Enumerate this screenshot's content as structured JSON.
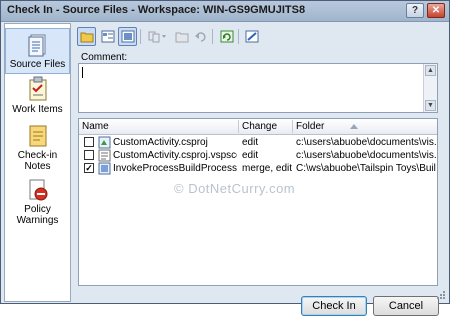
{
  "window": {
    "title": "Check In - Source Files - Workspace: WIN-GS9GMUJITS8"
  },
  "sidebar": {
    "items": [
      {
        "label": "Source Files",
        "icon": "source-files-icon",
        "selected": true
      },
      {
        "label": "Work Items",
        "icon": "work-items-icon"
      },
      {
        "label": "Check-in Notes",
        "icon": "checkin-notes-icon"
      },
      {
        "label": "Policy Warnings",
        "icon": "policy-warnings-icon"
      }
    ]
  },
  "comment": {
    "label": "Comment:",
    "value": ""
  },
  "files": {
    "columns": [
      "Name",
      "Change",
      "Folder"
    ],
    "rows": [
      {
        "checked": false,
        "name": "CustomActivity.csproj",
        "change": "edit",
        "folder": "c:\\users\\abuobe\\documents\\vis..."
      },
      {
        "checked": false,
        "name": "CustomActivity.csproj.vspscc",
        "change": "edit",
        "folder": "c:\\users\\abuobe\\documents\\vis..."
      },
      {
        "checked": true,
        "name": "InvokeProcessBuildProcessTe...",
        "change": "merge, edit",
        "folder": "C:\\ws\\abuobe\\Tailspin Toys\\Buil..."
      }
    ]
  },
  "watermark": "© DotNetCurry.com",
  "buttons": {
    "check_in": "Check In",
    "cancel": "Cancel"
  },
  "colors": {
    "accent": "#5c82b9",
    "window_bg": "#dfe7f1"
  }
}
